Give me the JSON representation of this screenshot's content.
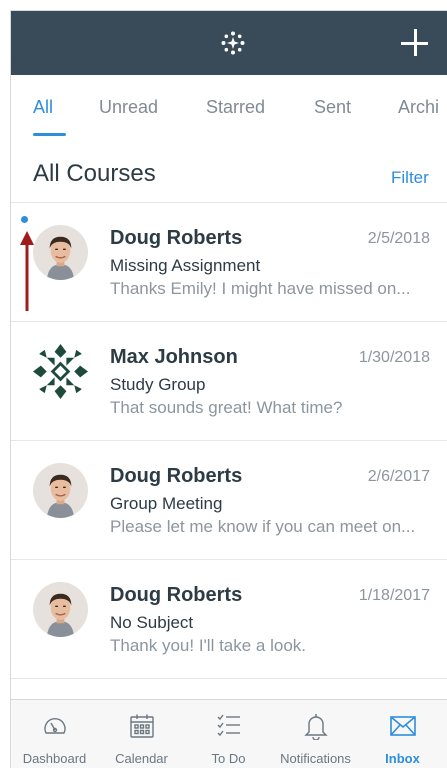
{
  "header": {
    "logo_icon": "canvas-logo-icon",
    "add_icon": "plus-icon"
  },
  "tabs": [
    {
      "label": "All",
      "active": true
    },
    {
      "label": "Unread",
      "active": false
    },
    {
      "label": "Starred",
      "active": false
    },
    {
      "label": "Sent",
      "active": false
    },
    {
      "label": "Archi",
      "active": false
    }
  ],
  "section": {
    "title": "All Courses",
    "filter_label": "Filter"
  },
  "messages": [
    {
      "sender": "Doug Roberts",
      "date": "2/5/2018",
      "subject": "Missing Assignment",
      "preview": "Thanks Emily! I might have missed on...",
      "unread": true,
      "avatar": "photo"
    },
    {
      "sender": "Max Johnson",
      "date": "1/30/2018",
      "subject": "Study Group",
      "preview": "That sounds great! What time?",
      "unread": false,
      "avatar": "pattern"
    },
    {
      "sender": "Doug Roberts",
      "date": "2/6/2017",
      "subject": "Group Meeting",
      "preview": "Please let me know if you can meet on...",
      "unread": false,
      "avatar": "photo"
    },
    {
      "sender": "Doug Roberts",
      "date": "1/18/2017",
      "subject": "No Subject",
      "preview": "Thank you! I'll take a look.",
      "unread": false,
      "avatar": "photo"
    }
  ],
  "bottom_nav": [
    {
      "label": "Dashboard",
      "icon": "dashboard-gauge-icon",
      "active": false
    },
    {
      "label": "Calendar",
      "icon": "calendar-icon",
      "active": false
    },
    {
      "label": "To Do",
      "icon": "todo-list-icon",
      "active": false
    },
    {
      "label": "Notifications",
      "icon": "bell-icon",
      "active": false
    },
    {
      "label": "Inbox",
      "icon": "envelope-icon",
      "active": true
    }
  ],
  "colors": {
    "header_bg": "#394b58",
    "accent": "#2d8ede",
    "annotation_arrow": "#a01c1c"
  }
}
